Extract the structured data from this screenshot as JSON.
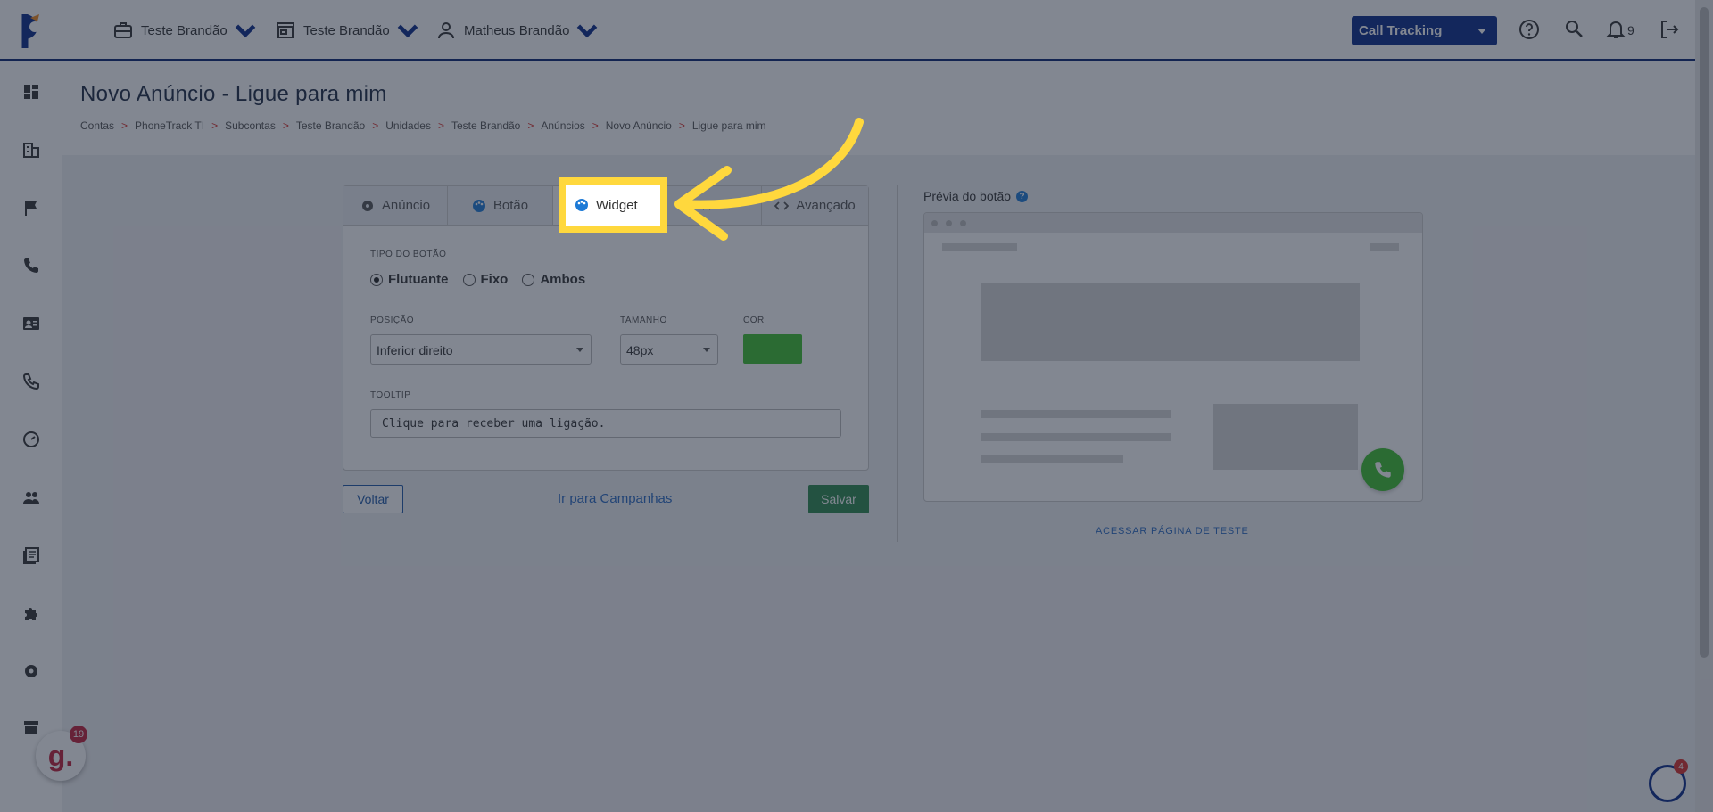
{
  "header": {
    "menus": [
      {
        "label": "Teste Brandão",
        "icon": "briefcase-icon"
      },
      {
        "label": "Teste Brandão",
        "icon": "store-icon"
      },
      {
        "label": "Matheus Brandão",
        "icon": "user-icon"
      }
    ],
    "product_select": "Call Tracking",
    "notification_count": "9"
  },
  "sidebar": {
    "icons": [
      "dashboard-icon",
      "building-icon",
      "flag-icon",
      "phone-icon",
      "contact-card-icon",
      "phone-outline-icon",
      "speed-icon",
      "users-icon",
      "book-icon",
      "puzzle-icon",
      "gear-icon",
      "store-icon"
    ]
  },
  "page": {
    "title": "Novo Anúncio - Ligue para mim",
    "breadcrumb": [
      "Contas",
      "PhoneTrack TI",
      "Subcontas",
      "Teste Brandão",
      "Unidades",
      "Teste Brandão",
      "Anúncios",
      "Novo Anúncio",
      "Ligue para mim"
    ],
    "breadcrumb_sep": ">"
  },
  "form": {
    "tabs": [
      {
        "label": "Anúncio",
        "icon": "gear-icon"
      },
      {
        "label": "Botão",
        "icon": "palette-icon"
      },
      {
        "label": "Widget",
        "icon": "palette-icon"
      },
      {
        "label": "",
        "icon": "code-icon"
      },
      {
        "label": "Avançado",
        "icon": "code-icon"
      }
    ],
    "button_type_label": "TIPO DO BOTÃO",
    "button_type_options": [
      "Flutuante",
      "Fixo",
      "Ambos"
    ],
    "button_type_selected": "Flutuante",
    "position_label": "POSIÇÃO",
    "position_value": "Inferior direito",
    "size_label": "TAMANHO",
    "size_value": "48px",
    "color_label": "COR",
    "color_value": "#3ec22f",
    "tooltip_label": "TOOLTIP",
    "tooltip_value": "Clique para receber uma ligação.",
    "back_button": "Voltar",
    "campaigns_link": "Ir para Campanhas",
    "save_button": "Salvar"
  },
  "preview": {
    "title": "Prévia do botão",
    "help": "?",
    "test_page_link": "ACESSAR PÁGINA DE TESTE"
  },
  "widgets": {
    "g_count": "19",
    "p_count": "4",
    "g_letter": "g."
  },
  "colors": {
    "brand_navy": "#0a2a8a",
    "accent_green": "#3ec22f",
    "save_green": "#2d8a4e",
    "highlight_yellow": "#ffd83d"
  }
}
